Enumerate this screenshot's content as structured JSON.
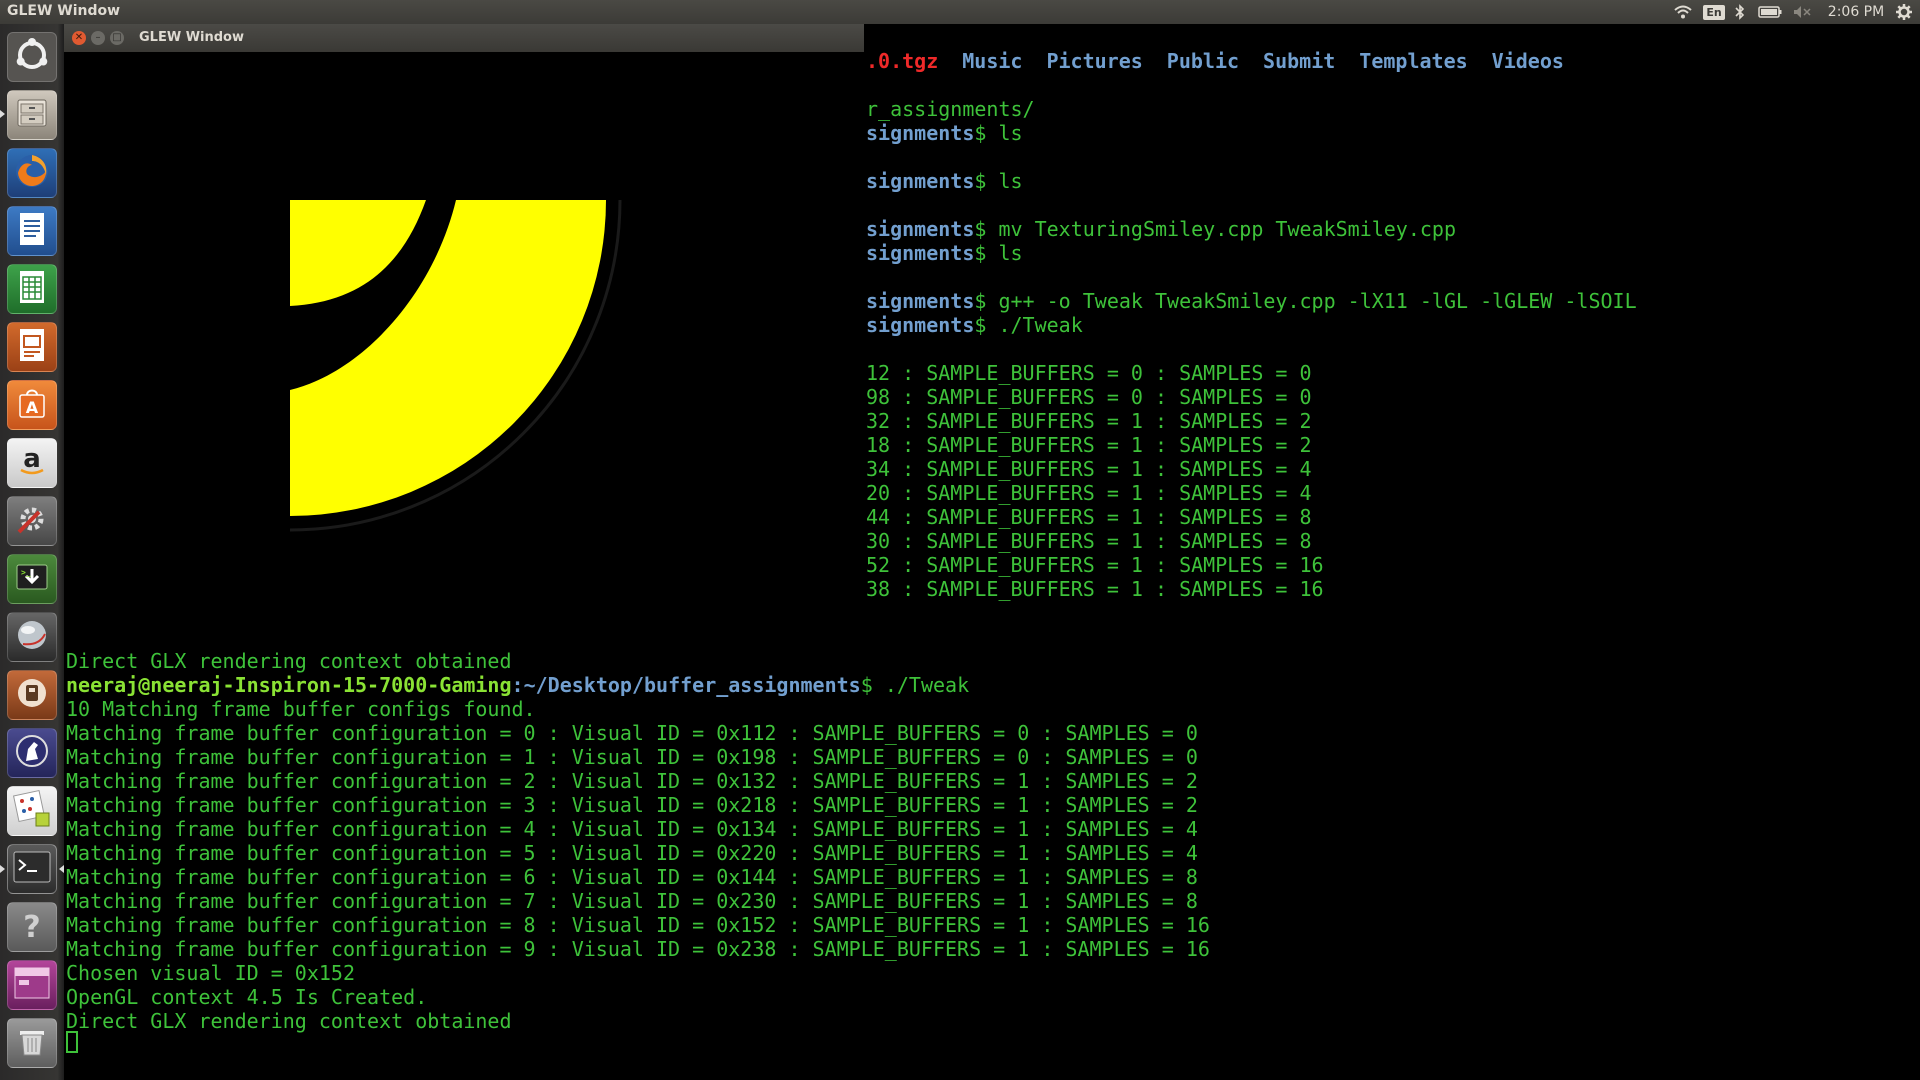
{
  "top_panel": {
    "title": "GLEW Window",
    "keyboard_layout": "En",
    "clock": "2:06 PM",
    "icons": [
      "wifi-icon",
      "keyboard-icon",
      "bluetooth-icon",
      "battery-icon",
      "volume-muted-icon",
      "settings-gear-icon"
    ]
  },
  "launcher": {
    "items": [
      {
        "name": "dash-home",
        "icon": "ubuntu-logo-icon"
      },
      {
        "name": "files",
        "icon": "file-cabinet-icon"
      },
      {
        "name": "firefox",
        "icon": "firefox-icon"
      },
      {
        "name": "writer",
        "icon": "writer-document-icon"
      },
      {
        "name": "calc",
        "icon": "calc-spreadsheet-icon"
      },
      {
        "name": "impress",
        "icon": "impress-presentation-icon"
      },
      {
        "name": "software-center",
        "icon": "shopping-bag-icon"
      },
      {
        "name": "amazon",
        "icon": "amazon-icon"
      },
      {
        "name": "system-settings",
        "icon": "settings-tools-icon"
      },
      {
        "name": "downloader",
        "icon": "download-arrow-icon"
      },
      {
        "name": "sphere-app",
        "icon": "sphere-icon"
      },
      {
        "name": "tool-app",
        "icon": "tool-icon"
      },
      {
        "name": "eclipse",
        "icon": "horse-icon"
      },
      {
        "name": "calculator-app",
        "icon": "numeric-calculator-icon"
      },
      {
        "name": "terminal",
        "icon": "terminal-icon"
      },
      {
        "name": "help",
        "icon": "help-icon"
      },
      {
        "name": "workspace-switcher",
        "icon": "workspaces-icon"
      },
      {
        "name": "trash",
        "icon": "trash-icon"
      }
    ]
  },
  "glew_window": {
    "title": "GLEW Window",
    "controls": [
      "close",
      "minimize",
      "maximize"
    ],
    "colors": {
      "smiley": "#ffff00",
      "background": "#000000"
    }
  },
  "terminal": {
    "colors": {
      "text": "#3ec23a",
      "user": "#8ae234",
      "path": "#729fcf",
      "archive": "#ef2929"
    },
    "ls_row": [
      {
        "text": ".0.tgz",
        "kind": "archive"
      },
      {
        "text": "Music",
        "kind": "dir"
      },
      {
        "text": "Pictures",
        "kind": "dir"
      },
      {
        "text": "Public",
        "kind": "dir"
      },
      {
        "text": "Submit",
        "kind": "dir"
      },
      {
        "text": "Templates",
        "kind": "dir"
      },
      {
        "text": "Videos",
        "kind": "dir"
      }
    ],
    "right_lines": [
      {
        "path": "r_assignments/",
        "cmd": ""
      },
      {
        "path": "signments",
        "cmd": "$ ls"
      },
      {
        "path": "signments",
        "cmd": "$ ls"
      },
      {
        "path": "signments",
        "cmd": "$ mv TexturingSmiley.cpp TweakSmiley.cpp"
      },
      {
        "path": "signments",
        "cmd": "$ ls"
      },
      {
        "path": "signments",
        "cmd": "$ g++ -o Tweak TweakSmiley.cpp -lX11 -lGL -lGLEW -lSOIL"
      },
      {
        "path": "signments",
        "cmd": "$ ./Tweak"
      }
    ],
    "right_configs": [
      "12 : SAMPLE_BUFFERS = 0 : SAMPLES = 0",
      "98 : SAMPLE_BUFFERS = 0 : SAMPLES = 0",
      "32 : SAMPLE_BUFFERS = 1 : SAMPLES = 2",
      "18 : SAMPLE_BUFFERS = 1 : SAMPLES = 2",
      "34 : SAMPLE_BUFFERS = 1 : SAMPLES = 4",
      "20 : SAMPLE_BUFFERS = 1 : SAMPLES = 4",
      "44 : SAMPLE_BUFFERS = 1 : SAMPLES = 8",
      "30 : SAMPLE_BUFFERS = 1 : SAMPLES = 8",
      "52 : SAMPLE_BUFFERS = 1 : SAMPLES = 16",
      "38 : SAMPLE_BUFFERS = 1 : SAMPLES = 16"
    ],
    "context_line_1": "Direct GLX rendering context obtained",
    "prompt_user": "neeraj@neeraj-Inspiron-15-7000-Gaming",
    "prompt_path": ":~/Desktop/buffer_assignments",
    "prompt_cmd": "$ ./Tweak",
    "configs_found": "10 Matching frame buffer configs found.",
    "config_lines": [
      "Matching frame buffer configuration = 0 : Visual ID = 0x112 : SAMPLE_BUFFERS = 0 : SAMPLES = 0",
      "Matching frame buffer configuration = 1 : Visual ID = 0x198 : SAMPLE_BUFFERS = 0 : SAMPLES = 0",
      "Matching frame buffer configuration = 2 : Visual ID = 0x132 : SAMPLE_BUFFERS = 1 : SAMPLES = 2",
      "Matching frame buffer configuration = 3 : Visual ID = 0x218 : SAMPLE_BUFFERS = 1 : SAMPLES = 2",
      "Matching frame buffer configuration = 4 : Visual ID = 0x134 : SAMPLE_BUFFERS = 1 : SAMPLES = 4",
      "Matching frame buffer configuration = 5 : Visual ID = 0x220 : SAMPLE_BUFFERS = 1 : SAMPLES = 4",
      "Matching frame buffer configuration = 6 : Visual ID = 0x144 : SAMPLE_BUFFERS = 1 : SAMPLES = 8",
      "Matching frame buffer configuration = 7 : Visual ID = 0x230 : SAMPLE_BUFFERS = 1 : SAMPLES = 8",
      "Matching frame buffer configuration = 8 : Visual ID = 0x152 : SAMPLE_BUFFERS = 1 : SAMPLES = 16",
      "Matching frame buffer configuration = 9 : Visual ID = 0x238 : SAMPLE_BUFFERS = 1 : SAMPLES = 16"
    ],
    "chosen_visual": "Chosen visual ID = 0x152",
    "opengl_context": "OpenGL context 4.5 Is Created.",
    "context_line_2": "Direct GLX rendering context obtained"
  }
}
